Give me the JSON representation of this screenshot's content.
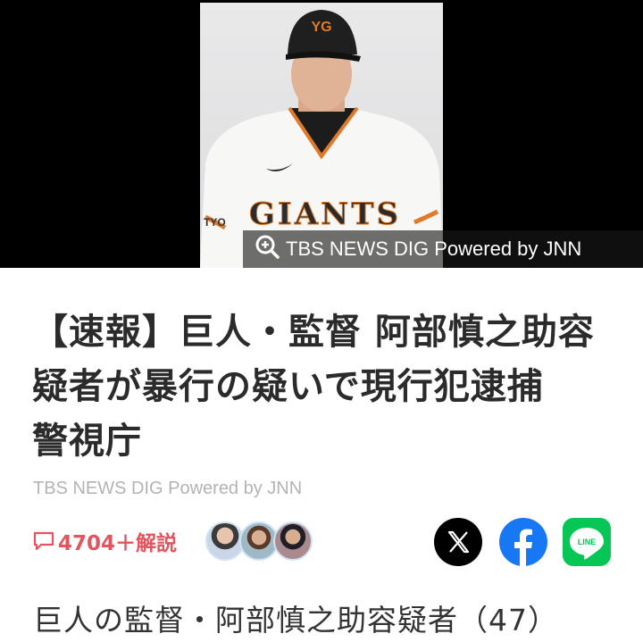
{
  "hero": {
    "cap_logo": "YG",
    "jersey_text": "GIANTS",
    "sleeve_text": "TYO",
    "credit": "TBS NEWS DIG Powered by JNN"
  },
  "article": {
    "title": "【速報】巨人・監督 阿部慎之助容疑者が暴行の疑いで現行犯逮捕　警視庁",
    "source": "TBS NEWS DIG Powered by JNN",
    "lead": "巨人の監督・阿部慎之助容疑者（47）"
  },
  "comments": {
    "label": "4704＋解説"
  },
  "icons": {
    "zoom": "zoom-in-icon",
    "comment": "comment-bubble-icon",
    "x": "x-icon",
    "facebook": "facebook-icon",
    "line": "line-icon"
  },
  "colors": {
    "comment_accent": "#e2545e",
    "facebook": "#1877f2",
    "line": "#06c755",
    "x": "#000000",
    "source_text": "#b3b3b3"
  }
}
